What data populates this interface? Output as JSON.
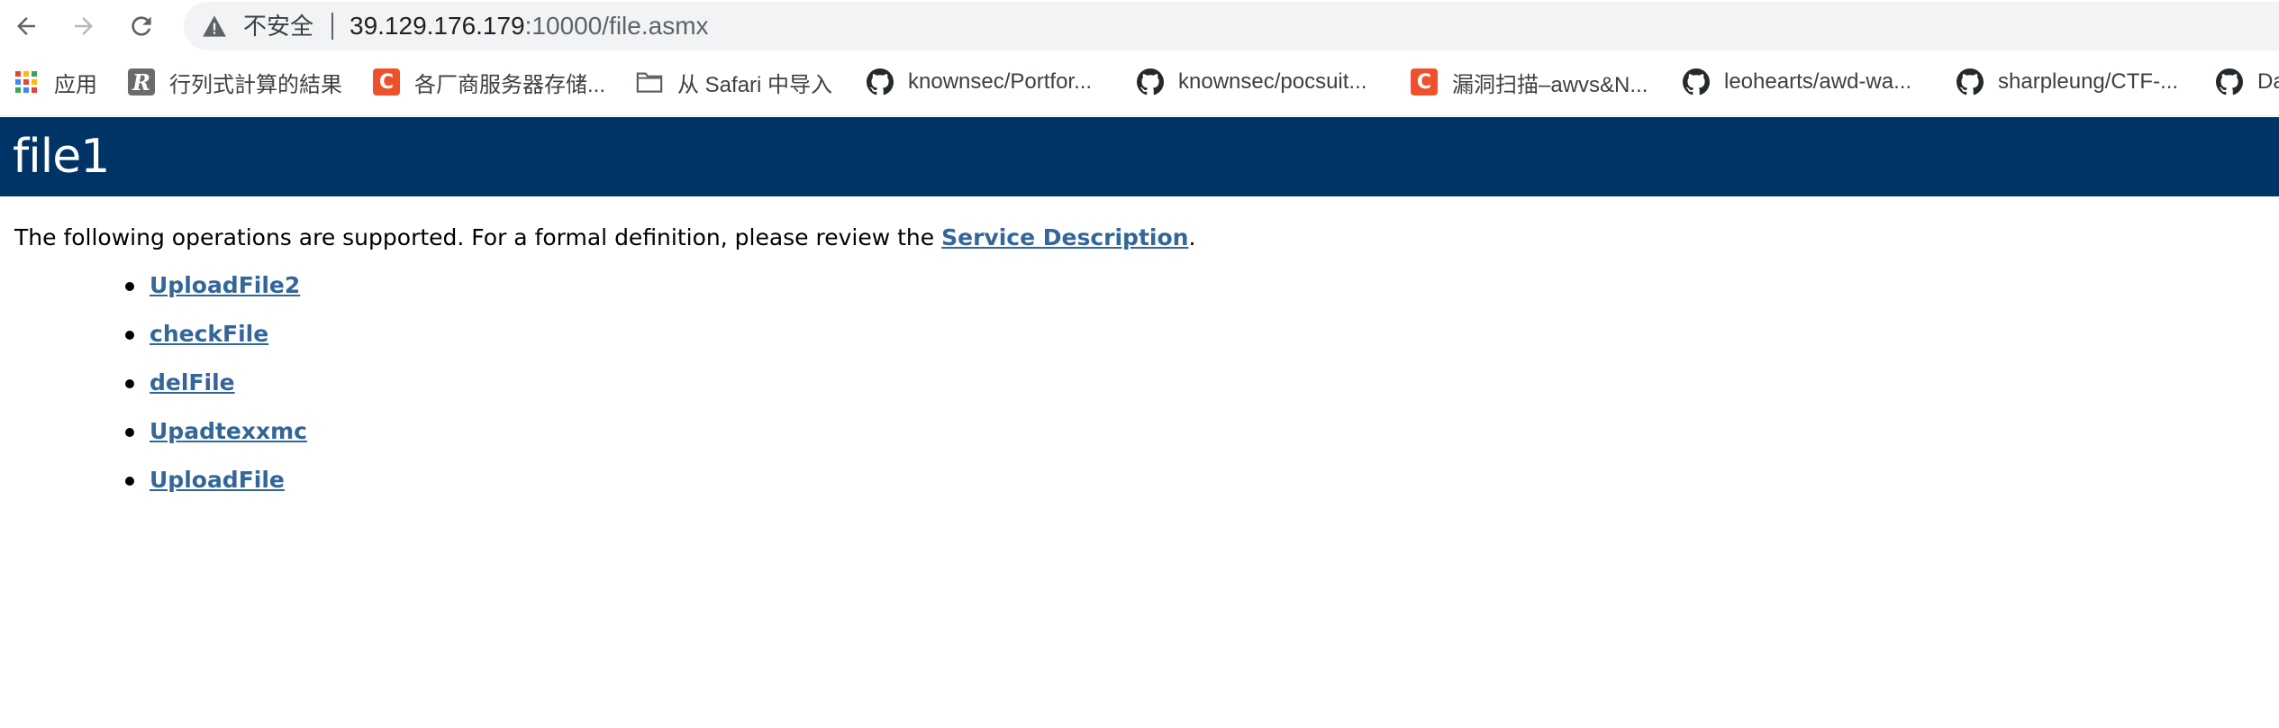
{
  "browser": {
    "security_label": "不安全",
    "url_host": "39.129.176.179",
    "url_rest": ":10000/file.asmx",
    "bookmarks": [
      {
        "label": "应用",
        "icon": "apps-grid-icon"
      },
      {
        "label": "行列式計算的結果",
        "icon": "r-logo-icon"
      },
      {
        "label": "各厂商服务器存储...",
        "icon": "c-logo-icon"
      },
      {
        "label": "从 Safari 中导入",
        "icon": "folder-icon"
      },
      {
        "label": "knownsec/Portfor...",
        "icon": "github-icon"
      },
      {
        "label": "knownsec/pocsuit...",
        "icon": "github-icon"
      },
      {
        "label": "漏洞扫描–awvs&N...",
        "icon": "c-logo-icon"
      },
      {
        "label": "leohearts/awd-wa...",
        "icon": "github-icon"
      },
      {
        "label": "sharpleung/CTF-...",
        "icon": "github-icon"
      },
      {
        "label": "Da",
        "icon": "github-icon"
      }
    ]
  },
  "page": {
    "title": "file1",
    "intro_text": "The following operations are supported. For a formal definition, please review the ",
    "service_description_link": "Service Description",
    "intro_end": ".",
    "operations": [
      "UploadFile2",
      "checkFile",
      "delFile",
      "Upadtexxmc",
      "UploadFile"
    ]
  },
  "colors": {
    "banner_bg": "#003366",
    "link": "#336699",
    "c_logo": "#f0502c"
  }
}
